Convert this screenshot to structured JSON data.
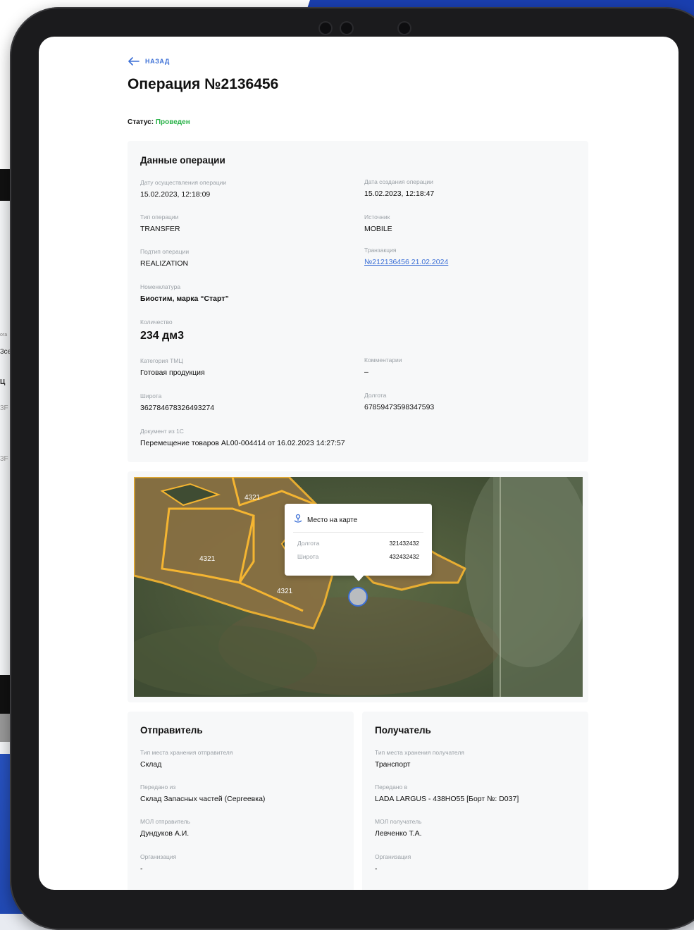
{
  "page": {
    "back_label": "НАЗАД",
    "title": "Операция №2136456",
    "status_label": "Статус:",
    "status_value": "Проведен",
    "status_color": "#2bb34a",
    "accent_color": "#3b6fd6"
  },
  "side_peek": {
    "texts": [
      "ora",
      "3ce",
      "Ц",
      "3F",
      "3F"
    ]
  },
  "operation": {
    "title": "Данные операции",
    "fields": [
      {
        "label": "Дату осуществления операции",
        "value": "15.02.2023, 12:18:09"
      },
      {
        "label": "Дата создания операции",
        "value": "15.02.2023, 12:18:47"
      },
      {
        "label": "Тип операции",
        "value": "TRANSFER"
      },
      {
        "label": "Источник",
        "value": "MOBILE"
      },
      {
        "label": "Подтип операции",
        "value": "REALIZATION"
      },
      {
        "label": "Транзакция",
        "value": "№212136456 21.02.2024"
      },
      {
        "label": "Номенклатура",
        "value": "Биостим, марка “Старт”"
      },
      {
        "label": "Количество",
        "value": "234 дм3"
      },
      {
        "label": "Категория ТМЦ",
        "value": "Готовая продукция"
      },
      {
        "label": "Комментарии",
        "value": "–"
      },
      {
        "label": "Широта",
        "value": "362784678326493274"
      },
      {
        "label": "Долгота",
        "value": "67859473598347593"
      },
      {
        "label": "Документ из 1С",
        "value": "Перемещение товаров AL00-004414 от 16.02.2023 14:27:57"
      }
    ]
  },
  "map": {
    "field_labels": [
      "4321",
      "4321",
      "4321"
    ],
    "popup": {
      "title": "Место на карте",
      "icon": "location-pin-icon",
      "rows": [
        {
          "key": "Долгота",
          "value": "321432432"
        },
        {
          "key": "Широта",
          "value": "432432432"
        }
      ]
    }
  },
  "sender": {
    "title": "Отправитель",
    "fields": [
      {
        "label": "Тип места хранения отправителя",
        "value": "Склад"
      },
      {
        "label": "Передано из",
        "value": "Склад Запасных частей (Сергеевка)"
      },
      {
        "label": "МОЛ отправитель",
        "value": "Дундуков А.И."
      },
      {
        "label": "Организация",
        "value": "-"
      }
    ]
  },
  "receiver": {
    "title": "Получатель",
    "fields": [
      {
        "label": "Тип места хранения получателя",
        "value": "Транспорт"
      },
      {
        "label": "Передано в",
        "value": "LADA LARGUS - 438НО55 [Борт №: D037]"
      },
      {
        "label": "МОЛ получатель",
        "value": "Левченко Т.А."
      },
      {
        "label": "Организация",
        "value": "-"
      }
    ]
  }
}
